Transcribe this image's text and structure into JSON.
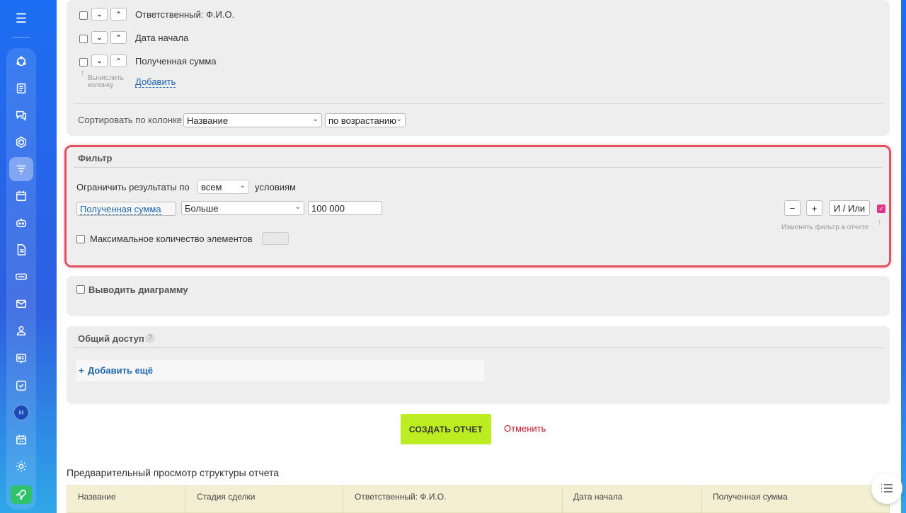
{
  "columns_section": {
    "rows": [
      {
        "label": "Ответственный: Ф.И.О."
      },
      {
        "label": "Дата начала"
      },
      {
        "label": "Полученная сумма"
      }
    ],
    "calc_hint_line1": "Вычислить",
    "calc_hint_line2": "колонку",
    "add_link": "Добавить",
    "sort_label": "Сортировать по колонке",
    "sort_column_value": "Название",
    "sort_order_value": "по возрастанию"
  },
  "filter": {
    "title": "Фильтр",
    "limit_prefix": "Ограничить результаты по",
    "limit_value": "всем",
    "limit_suffix": "условиям",
    "field": "Полученная сумма",
    "operator": "Больше",
    "value": "100 000",
    "minus": "−",
    "plus": "+",
    "and_or": "И / Или",
    "edit_hint": "Изменять фильтр в отчете",
    "max_items_label": "Максимальное количество элементов"
  },
  "chart_section": {
    "label": "Выводить диаграмму"
  },
  "access_section": {
    "title": "Общий доступ",
    "help": "?",
    "add_more": "Добавить ещё",
    "plus": "+"
  },
  "actions": {
    "create": "СОЗДАТЬ ОТЧЕТ",
    "cancel": "Отменить"
  },
  "preview": {
    "title": "Предварительный просмотр структуры отчета",
    "headers": [
      "Название",
      "Стадия сделки",
      "Ответственный: Ф.И.О.",
      "Дата начала",
      "Полученная сумма"
    ]
  },
  "sidebar": {
    "avatar_letter": "Н"
  }
}
